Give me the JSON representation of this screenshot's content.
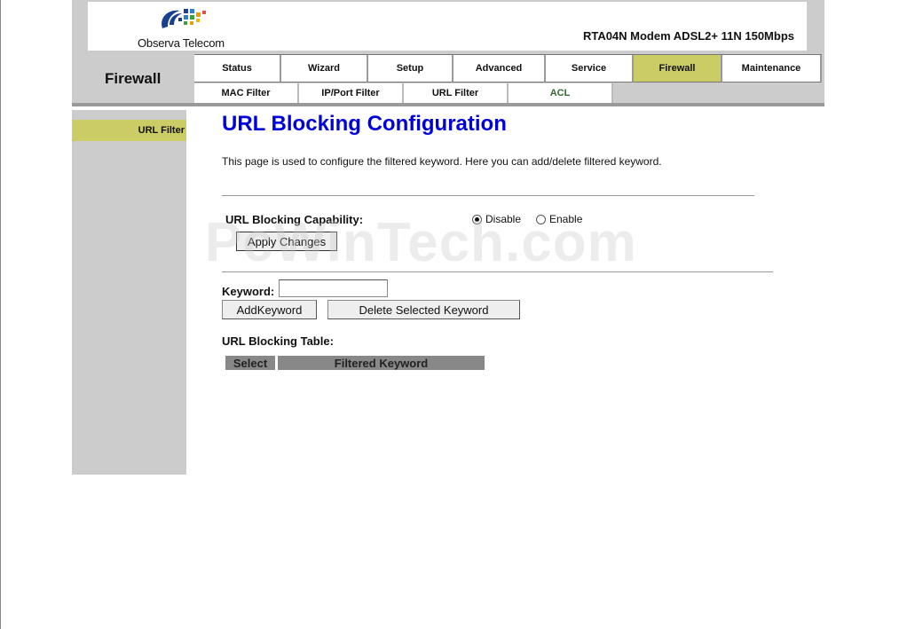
{
  "brand": {
    "name": "Observa Telecom",
    "model": "RTA04N Modem ADSL2+ 11N 150Mbps"
  },
  "section_title": "Firewall",
  "main_nav": [
    {
      "label": "Status",
      "active": false
    },
    {
      "label": "Wizard",
      "active": false
    },
    {
      "label": "Setup",
      "active": false
    },
    {
      "label": "Advanced",
      "active": false
    },
    {
      "label": "Service",
      "active": false
    },
    {
      "label": "Firewall",
      "active": true
    },
    {
      "label": "Maintenance",
      "active": false
    }
  ],
  "sub_nav": [
    {
      "label": "MAC Filter"
    },
    {
      "label": "IP/Port Filter"
    },
    {
      "label": "URL Filter"
    },
    {
      "label": "ACL"
    }
  ],
  "sidebar": {
    "items": [
      {
        "label": "URL Filter",
        "active": true
      }
    ]
  },
  "main": {
    "title": "URL Blocking Configuration",
    "description": "This page is used to configure the filtered keyword. Here you can add/delete filtered keyword.",
    "capability_label": "URL Blocking Capability:",
    "radio_disable": "Disable",
    "radio_enable": "Enable",
    "capability_value": "Disable",
    "apply_label": "Apply Changes",
    "keyword_label": "Keyword:",
    "keyword_value": "",
    "add_label": "AddKeyword",
    "delete_label": "Delete Selected Keyword",
    "table_label": "URL Blocking Table:",
    "table_columns": [
      "Select",
      "Filtered Keyword"
    ],
    "table_rows": []
  },
  "watermark": "PcWinTech.com",
  "colors": {
    "accent": "#cccc66",
    "title_blue": "#0000dd",
    "frame_gray": "#cccccc",
    "table_head": "#888888"
  }
}
